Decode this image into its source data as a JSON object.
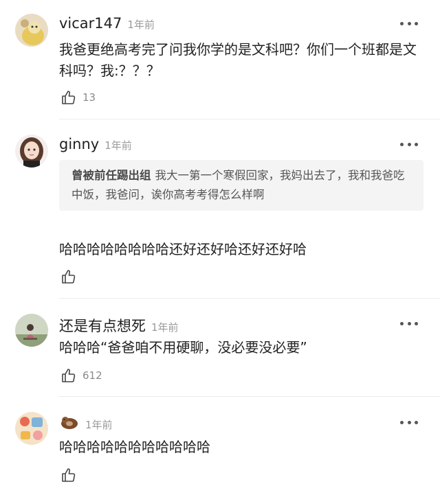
{
  "comments": [
    {
      "username": "vicar147",
      "time": "1年前",
      "text": "我爸更绝高考完了问我你学的是文科吧？你们一个班都是文科吗？我:？？？",
      "likes": "13",
      "avatar_icon": "avatar-cartoon-icon",
      "more_icon": "more-options-icon"
    },
    {
      "username": "ginny",
      "time": "1年前",
      "reply_to": {
        "name": "曾被前任踢出组",
        "text": "我大一第一个寒假回家，我妈出去了，我和我爸吃中饭，我爸问，诶你高考考得怎么样啊"
      },
      "text": "哈哈哈哈哈哈哈哈还好还好哈还好还好哈",
      "likes": "",
      "avatar_icon": "avatar-girl-icon",
      "more_icon": "more-options-icon"
    },
    {
      "username": "还是有点想死",
      "time": "1年前",
      "text": "哈哈哈“爸爸咱不用硬聊，没必要没必要”",
      "likes": "612",
      "avatar_icon": "avatar-sitting-figure-icon",
      "more_icon": "more-options-icon"
    },
    {
      "username": "",
      "username_icon": "otter-emoji-icon",
      "time": "1年前",
      "text": "哈哈哈哈哈哈哈哈哈哈哈",
      "likes": "",
      "avatar_icon": "avatar-illustration-icon",
      "more_icon": "more-options-icon"
    }
  ],
  "colors": {
    "background": "#ffffff",
    "text": "#222222",
    "muted": "#9a9a9a",
    "quote_bg": "#f4f4f4"
  }
}
